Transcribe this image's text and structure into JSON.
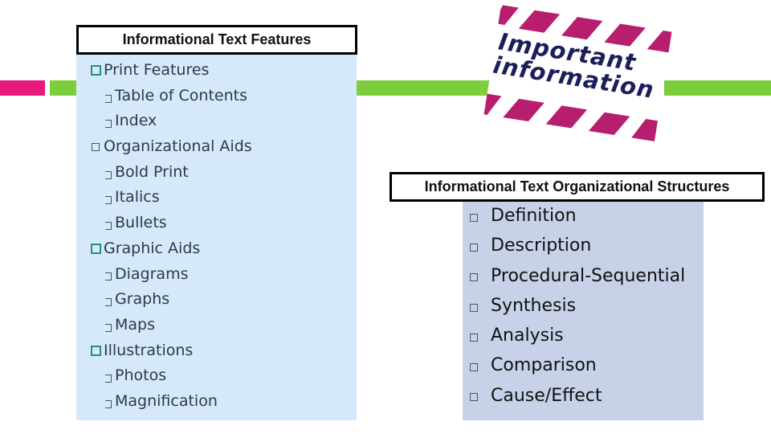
{
  "colors": {
    "accent_pink": "#e8197a",
    "accent_green": "#7dce3c",
    "features_panel_bg": "#d5e9fb",
    "structures_panel_bg": "#c7d1e8",
    "sign_stripe": "#b81e6e",
    "sign_text": "#1a1f5c",
    "bullet_teal": "#2a8a88"
  },
  "features": {
    "title": "Informational Text Features",
    "items": [
      {
        "level": 1,
        "label": "Print Features",
        "bullet": "teal-square-icon"
      },
      {
        "level": 2,
        "label": "Table of Contents",
        "bullet": "bracket-bullet-icon"
      },
      {
        "level": 2,
        "label": "Index",
        "bullet": "bracket-bullet-icon"
      },
      {
        "level": 1,
        "label": "Organizational Aids",
        "bullet": "small-square-icon"
      },
      {
        "level": 2,
        "label": "Bold Print",
        "bullet": "bracket-bullet-icon"
      },
      {
        "level": 2,
        "label": "Italics",
        "bullet": "bracket-bullet-icon"
      },
      {
        "level": 2,
        "label": "Bullets",
        "bullet": "bracket-bullet-icon"
      },
      {
        "level": 1,
        "label": "Graphic Aids",
        "bullet": "teal-square-icon"
      },
      {
        "level": 2,
        "label": "Diagrams",
        "bullet": "bracket-bullet-icon"
      },
      {
        "level": 2,
        "label": "Graphs",
        "bullet": "bracket-bullet-icon"
      },
      {
        "level": 2,
        "label": "Maps",
        "bullet": "bracket-bullet-icon"
      },
      {
        "level": 1,
        "label": "Illustrations",
        "bullet": "teal-square-icon"
      },
      {
        "level": 2,
        "label": "Photos",
        "bullet": "bracket-bullet-icon"
      },
      {
        "level": 2,
        "label": "Magnification",
        "bullet": "bracket-bullet-icon"
      }
    ]
  },
  "sign": {
    "line1": "Important",
    "line2": "information",
    "icon": "important-information-sign-icon"
  },
  "structures": {
    "title": "Informational Text Organizational Structures",
    "items": [
      {
        "label": "Definition",
        "bullet": "hollow-square-icon"
      },
      {
        "label": "Description",
        "bullet": "hollow-square-icon"
      },
      {
        "label": "Procedural-Sequential",
        "bullet": "hollow-square-icon"
      },
      {
        "label": "Synthesis",
        "bullet": "hollow-square-icon"
      },
      {
        "label": "Analysis",
        "bullet": "hollow-square-icon"
      },
      {
        "label": "Comparison",
        "bullet": "hollow-square-icon"
      },
      {
        "label": "Cause/Effect",
        "bullet": "hollow-square-icon"
      }
    ]
  }
}
